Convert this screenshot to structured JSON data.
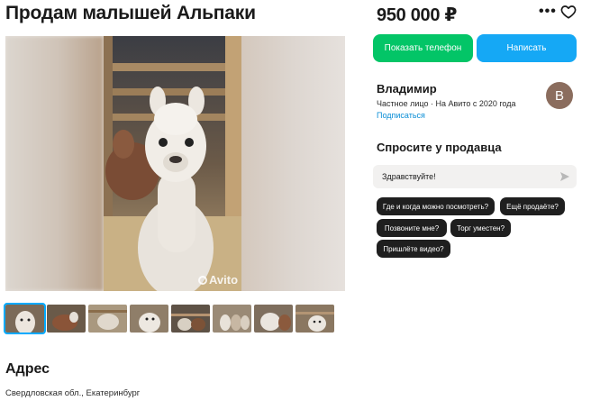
{
  "listing": {
    "title": "Продам малышей Альпаки",
    "price": "950 000 ₽"
  },
  "actions": {
    "more_icon": "more-dots-icon",
    "favorite_icon": "heart-icon",
    "phone_button": "Показать телефон",
    "message_button": "Написать"
  },
  "gallery": {
    "watermark": "Avito",
    "thumbnail_count": 8,
    "active_index": 0
  },
  "seller": {
    "name": "Владимир",
    "type": "Частное лицо",
    "separator": "·",
    "since": "На Авито с 2020 года",
    "subscribe": "Подписаться",
    "avatar_letter": "В",
    "avatar_color": "#8b6d5e"
  },
  "ask": {
    "title": "Спросите у продавца",
    "input_value": "Здравствуйте!",
    "questions": [
      "Где и когда можно посмотреть?",
      "Ещё продаёте?",
      "Позвоните мне?",
      "Торг уместен?",
      "Пришлёте видео?"
    ]
  },
  "address": {
    "title": "Адрес",
    "text": "Свердловская обл., Екатеринбург"
  },
  "colors": {
    "phone_button": "#03c567",
    "message_button": "#15a8f5",
    "link": "#0a8ed6",
    "chip": "#1f1f1f"
  }
}
